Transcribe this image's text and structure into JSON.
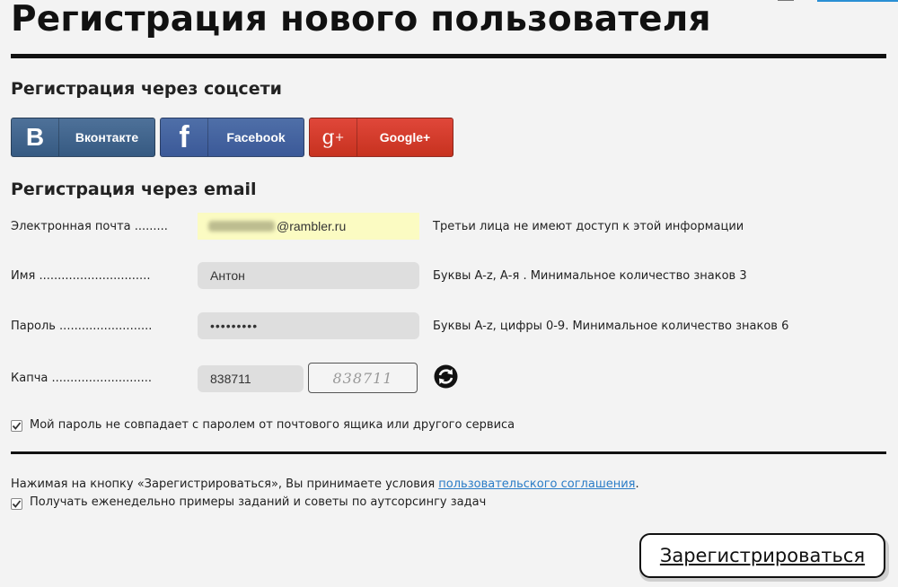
{
  "page": {
    "title": "Регистрация нового пользователя"
  },
  "social": {
    "heading": "Регистрация через соцсети",
    "buttons": [
      {
        "label": "Вконтакте",
        "icon": "vk-logo-icon",
        "color": "#4e7199"
      },
      {
        "label": "Facebook",
        "icon": "facebook-logo-icon",
        "color": "#3b5998"
      },
      {
        "label": "Google+",
        "icon": "google-plus-logo-icon",
        "color": "#d23c2a"
      }
    ]
  },
  "email_section": {
    "heading": "Регистрация через email",
    "fields": {
      "email": {
        "label": "Электронная почта .........",
        "value": "@rambler.ru",
        "hint": "Третьи лица не имеют доступ к этой информации"
      },
      "name": {
        "label": "Имя ..............................",
        "value": "Антон",
        "hint": "Буквы A-z, А-я . Минимальное количество знаков 3"
      },
      "password": {
        "label": "Пароль .........................",
        "value": "•••••••••",
        "hint": "Буквы A-z, цифры 0-9. Минимальное количество знаков 6"
      },
      "captcha": {
        "label": "Капча ...........................",
        "value": "838711",
        "image_text": "838711"
      }
    },
    "password_check": {
      "label": "Мой пароль не совпадает с паролем от почтового ящика или другого сервиса",
      "checked": true
    }
  },
  "agreement": {
    "text_before": "Нажимая на кнопку «Зарегистрироваться», Вы принимаете условия ",
    "link": "пользовательского соглашения",
    "text_after": ".",
    "newsletter": {
      "label": "Получать еженедельно примеры заданий и советы по аутсорсингу задач",
      "checked": true
    }
  },
  "submit": {
    "label": "Зарегистрироваться"
  },
  "colors": {
    "accent_link": "#2a7cc7",
    "email_field_bg": "#fbfbc2",
    "field_bg": "#dedede"
  }
}
